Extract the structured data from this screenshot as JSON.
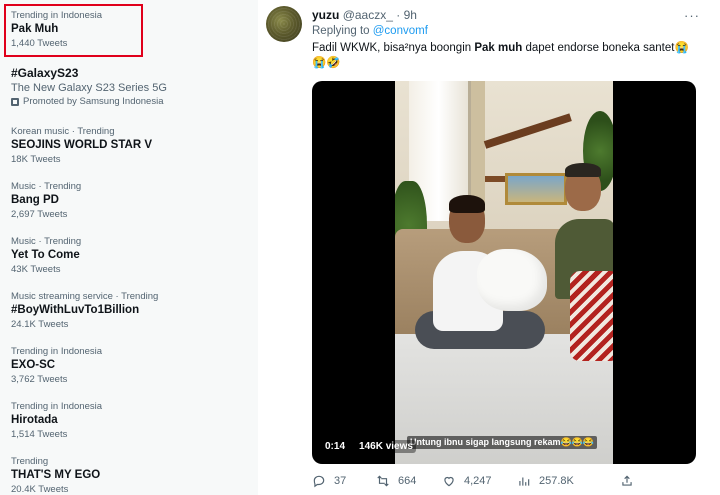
{
  "trends": [
    {
      "context": "Trending in Indonesia",
      "name": "Pak Muh",
      "count": "1,440 Tweets"
    },
    {
      "context": "",
      "name": "#GalaxyS23",
      "description": "The New Galaxy S23 Series 5G",
      "promoted": "Promoted by Samsung Indonesia"
    },
    {
      "context": "Korean music · Trending",
      "name": "SEOJINS WORLD STAR V",
      "count": "18K Tweets"
    },
    {
      "context": "Music · Trending",
      "name": "Bang PD",
      "count": "2,697 Tweets"
    },
    {
      "context": "Music · Trending",
      "name": "Yet To Come",
      "count": "43K Tweets"
    },
    {
      "context": "Music streaming service · Trending",
      "name": "#BoyWithLuvTo1Billion",
      "count": "24.1K Tweets"
    },
    {
      "context": "Trending in Indonesia",
      "name": "EXO-SC",
      "count": "3,762 Tweets"
    },
    {
      "context": "Trending in Indonesia",
      "name": "Hirotada",
      "count": "1,514 Tweets"
    },
    {
      "context": "Trending",
      "name": "THAT'S MY EGO",
      "count": "20.4K Tweets"
    }
  ],
  "tweet": {
    "display_name": "yuzu",
    "handle": "@aaczx_",
    "separator": "·",
    "time": "9h",
    "replying_label": "Replying to",
    "replying_to": "@convomf",
    "text_part1": "Fadil WKWK, bisa²nya boongin ",
    "text_bold": "Pak muh",
    "text_part2": " dapet endorse boneka santet😭",
    "text_line2": "😭🤣",
    "video": {
      "duration": "0:14",
      "views": "146K views",
      "caption": "Untung ibnu sigap langsung rekam😂😂😂"
    },
    "actions": {
      "replies": "37",
      "retweets": "664",
      "likes": "4,247",
      "views": "257.8K"
    },
    "more_label": "···"
  },
  "colors": {
    "accent": "#1d9bf0",
    "highlight_box": "#e0001b",
    "secondary_text": "#536471"
  }
}
